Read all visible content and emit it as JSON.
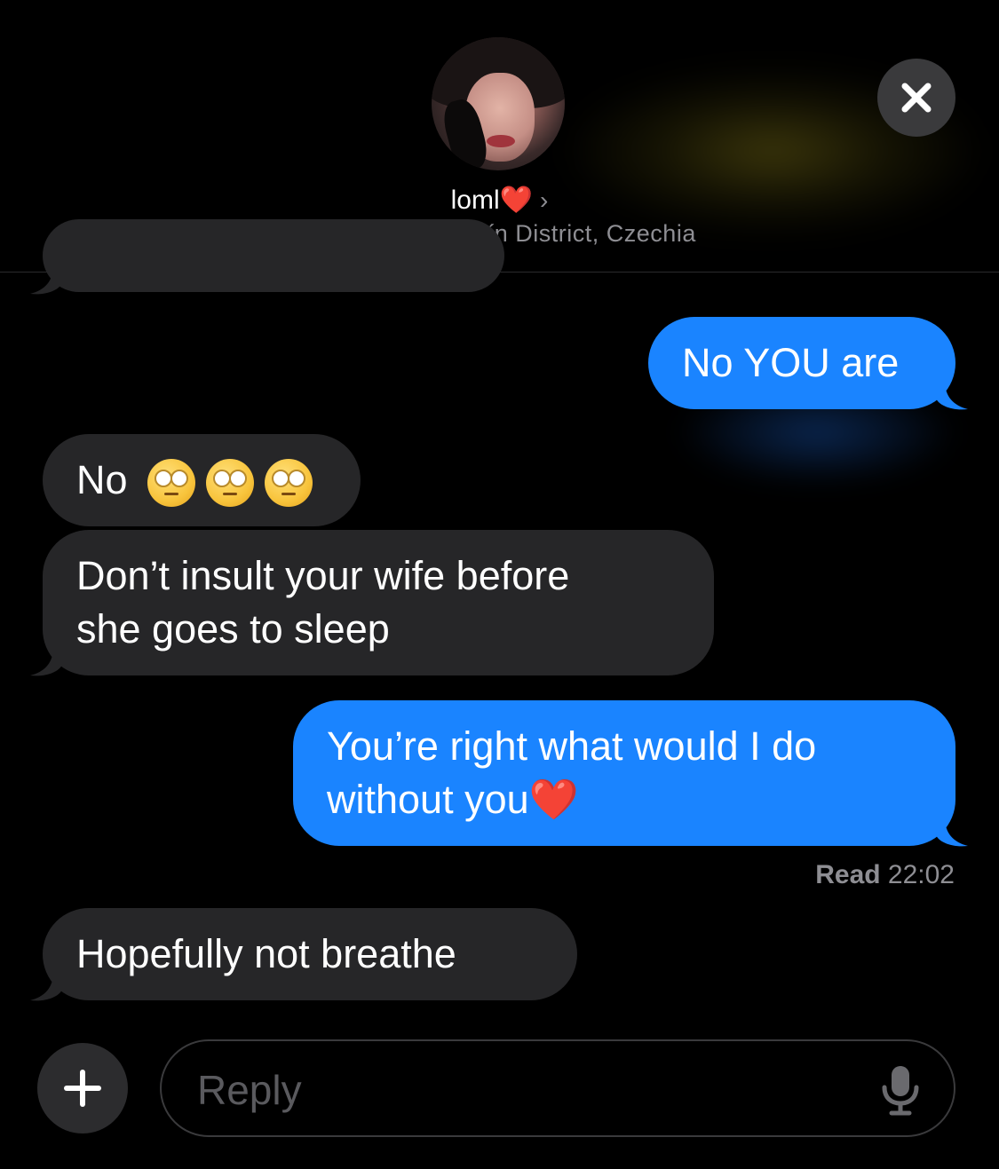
{
  "header": {
    "contact_name": "loml",
    "contact_emoji": "❤️",
    "chevron": "›",
    "location": "Dubňany, Hodonín District, Czechia",
    "close_icon": "close-icon",
    "avatar": "contact-avatar-photo"
  },
  "messages": [
    {
      "side": "sent",
      "text": "No YOU are"
    },
    {
      "side": "received",
      "text": "No",
      "emoji": "face-with-rolling-eyes x3"
    },
    {
      "side": "received",
      "line1": "Don’t insult your wife before",
      "line2": "she goes to sleep"
    },
    {
      "side": "sent",
      "line1": "You’re right what would I do",
      "line2": "without you",
      "emoji": "❤️"
    },
    {
      "side": "received",
      "text": "Hopefully not breathe"
    }
  ],
  "read_receipt": {
    "label": "Read",
    "time": "22:02"
  },
  "composer": {
    "plus_icon": "plus-icon",
    "placeholder": "Reply",
    "mic_icon": "microphone-icon"
  },
  "colors": {
    "background": "#000000",
    "sent_bubble": "#1a84ff",
    "received_bubble": "#262628",
    "secondary_text": "#8e8e93"
  }
}
